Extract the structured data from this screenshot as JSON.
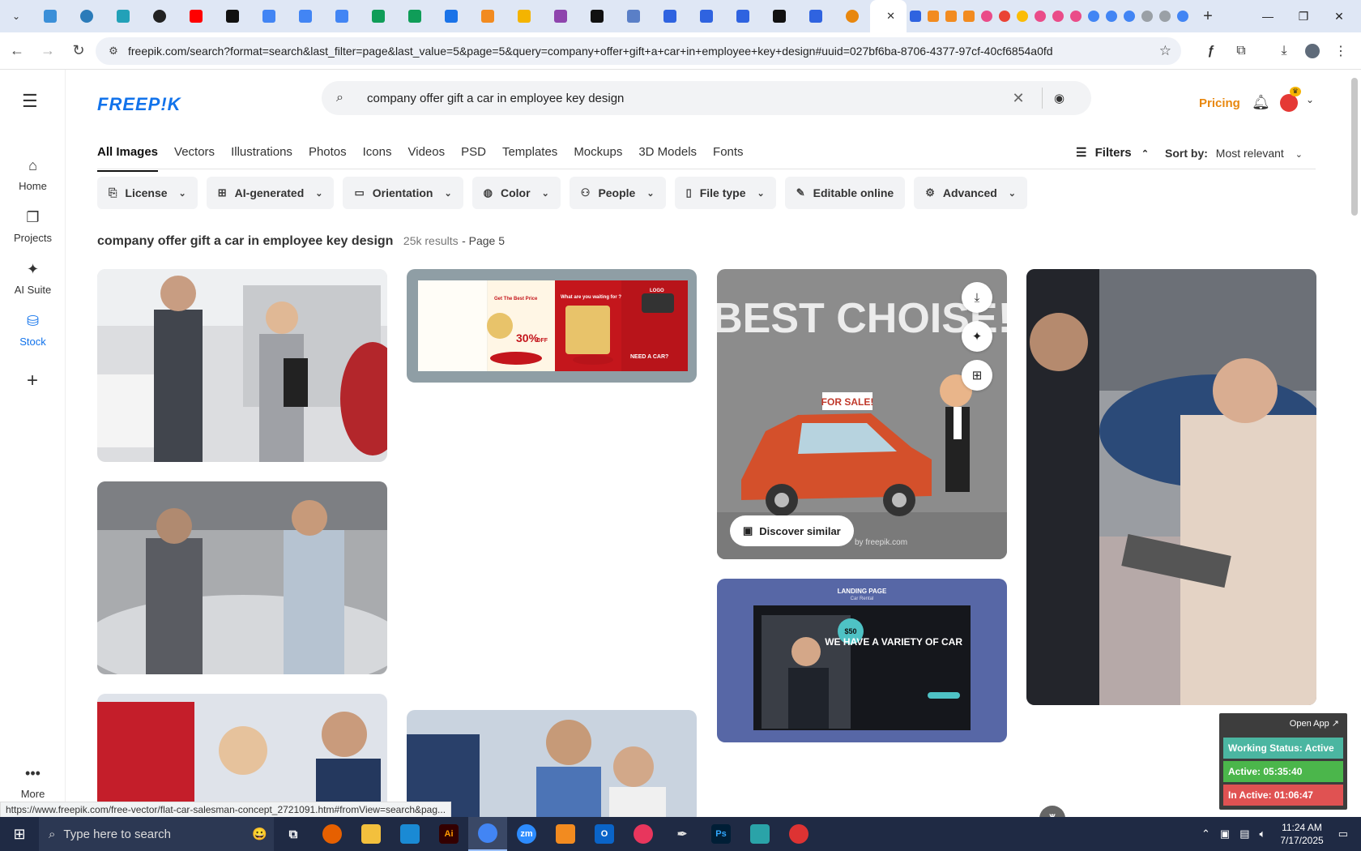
{
  "browser": {
    "active_tab_close": "✕",
    "new_tab": "+",
    "window_controls": {
      "minimize": "—",
      "maximize": "❐",
      "close": "✕"
    },
    "url": "freepik.com/search?format=search&last_filter=page&last_value=5&page=5&query=company+offer+gift+a+car+in+employee+key+design#uuid=027bf6ba-8706-4377-97cf-40cf6854a0fd"
  },
  "colors": {
    "brand": "#1273eb",
    "pricing": "#e8870e",
    "active_status": "#4bb6a1",
    "inactive_status": "#e05252",
    "taskbar": "#1f2a44"
  },
  "sidenav": {
    "items": [
      {
        "label": "Home",
        "icon": "home-icon"
      },
      {
        "label": "Projects",
        "icon": "projects-icon"
      },
      {
        "label": "AI Suite",
        "icon": "sparkle-icon"
      },
      {
        "label": "Stock",
        "icon": "stock-icon"
      }
    ],
    "more_label": "More"
  },
  "header": {
    "logo": "FREEP!K",
    "search_query": "company offer gift a car in employee key design",
    "pricing": "Pricing"
  },
  "tabs": [
    {
      "label": "All Images",
      "active": true
    },
    {
      "label": "Vectors"
    },
    {
      "label": "Illustrations"
    },
    {
      "label": "Photos"
    },
    {
      "label": "Icons"
    },
    {
      "label": "Videos"
    },
    {
      "label": "PSD"
    },
    {
      "label": "Templates"
    },
    {
      "label": "Mockups"
    },
    {
      "label": "3D Models"
    },
    {
      "label": "Fonts"
    }
  ],
  "filters_label": "Filters",
  "sort": {
    "label": "Sort by:",
    "value": "Most relevant"
  },
  "filter_chips": [
    {
      "label": "License",
      "icon": "license-icon",
      "dropdown": true
    },
    {
      "label": "AI-generated",
      "icon": "ai-icon",
      "dropdown": true
    },
    {
      "label": "Orientation",
      "icon": "orientation-icon",
      "dropdown": true
    },
    {
      "label": "Color",
      "icon": "palette-icon",
      "dropdown": true
    },
    {
      "label": "People",
      "icon": "people-icon",
      "dropdown": true
    },
    {
      "label": "File type",
      "icon": "file-icon",
      "dropdown": true
    },
    {
      "label": "Editable online",
      "icon": "edit-icon",
      "dropdown": false
    },
    {
      "label": "Advanced",
      "icon": "gear-icon",
      "dropdown": true
    }
  ],
  "results": {
    "query": "company offer gift a car in employee key design",
    "count": "25k results",
    "page": "- Page 5"
  },
  "cards": {
    "brochure": {
      "price_badge": "30%",
      "price_badge_sub": "OFF",
      "headline": "NEED A CAR?",
      "panel_text": "What are you waiting for ?",
      "logo": "LOGO",
      "top_text": "Get The Best Price"
    },
    "best_choice": {
      "title": "BEST CHOISE!",
      "sign": "FOR SALE!",
      "watermark": "by freepik.com",
      "discover": "Discover similar"
    },
    "landing": {
      "title": "LANDING PAGE",
      "subtitle": "Car Rental",
      "headline": "WE HAVE A VARIETY OF CAR",
      "price": "$50"
    }
  },
  "status_link": "https://www.freepik.com/free-vector/flat-car-salesman-concept_2721091.htm#fromView=search&pag...",
  "widget": {
    "open_app": "Open App ↗",
    "working": "Working Status: Active",
    "active": "Active: 05:35:40",
    "inactive": "In Active: 01:06:47"
  },
  "taskbar": {
    "search_placeholder": "Type here to search",
    "time": "11:24 AM",
    "date": "7/17/2025"
  }
}
